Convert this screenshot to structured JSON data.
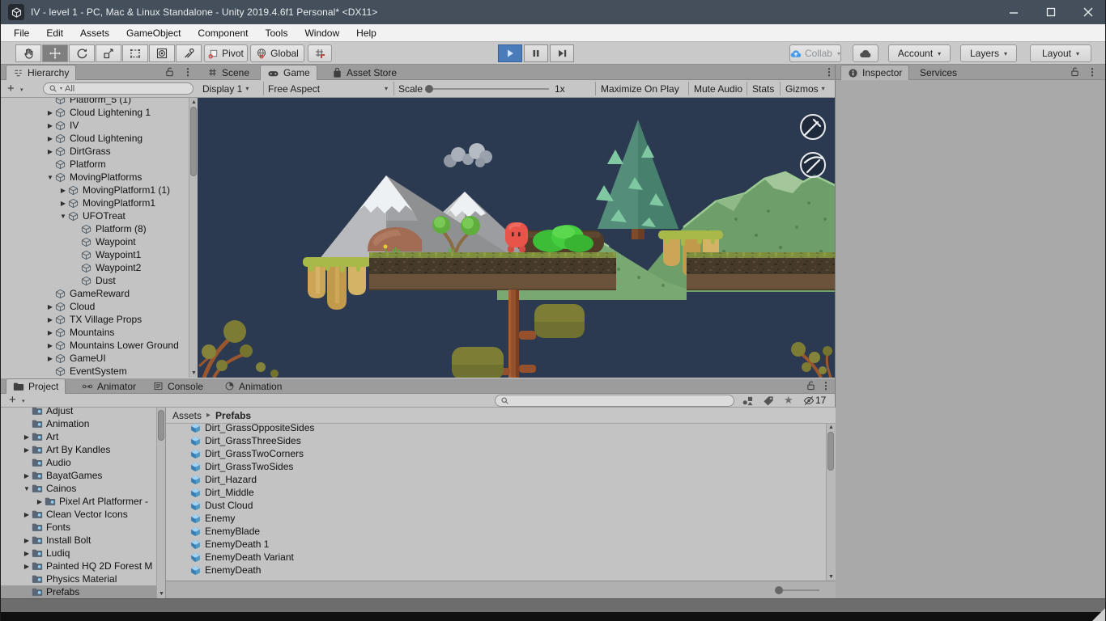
{
  "window": {
    "title": "IV - level 1 - PC, Mac & Linux Standalone - Unity 2019.4.6f1 Personal* <DX11>"
  },
  "menu": [
    "File",
    "Edit",
    "Assets",
    "GameObject",
    "Component",
    "Tools",
    "Window",
    "Help"
  ],
  "toolbar": {
    "pivot": "Pivot",
    "global": "Global",
    "collab": "Collab",
    "account": "Account",
    "layers": "Layers",
    "layout": "Layout"
  },
  "tabs": {
    "hierarchy": "Hierarchy",
    "scene": "Scene",
    "game": "Game",
    "asset_store": "Asset Store",
    "inspector": "Inspector",
    "services": "Services",
    "project": "Project",
    "animator": "Animator",
    "console": "Console",
    "animation": "Animation"
  },
  "hierarchy": {
    "search": "All",
    "items": [
      {
        "label": "Platform_5 (1)",
        "level": 2,
        "arrow": "none"
      },
      {
        "label": "Cloud Lightening 1",
        "level": 2,
        "arrow": "collapsed"
      },
      {
        "label": "IV",
        "level": 2,
        "arrow": "collapsed"
      },
      {
        "label": "Cloud Lightening",
        "level": 2,
        "arrow": "collapsed"
      },
      {
        "label": "DirtGrass",
        "level": 2,
        "arrow": "collapsed"
      },
      {
        "label": "Platform",
        "level": 2,
        "arrow": "none"
      },
      {
        "label": "MovingPlatforms",
        "level": 2,
        "arrow": "expanded"
      },
      {
        "label": "MovingPlatform1 (1)",
        "level": 3,
        "arrow": "collapsed"
      },
      {
        "label": "MovingPlatform1",
        "level": 3,
        "arrow": "collapsed"
      },
      {
        "label": "UFOTreat",
        "level": 3,
        "arrow": "expanded"
      },
      {
        "label": "Platform (8)",
        "level": 4,
        "arrow": "none"
      },
      {
        "label": "Waypoint",
        "level": 4,
        "arrow": "none"
      },
      {
        "label": "Waypoint1",
        "level": 4,
        "arrow": "none"
      },
      {
        "label": "Waypoint2",
        "level": 4,
        "arrow": "none"
      },
      {
        "label": "Dust",
        "level": 4,
        "arrow": "none"
      },
      {
        "label": "GameReward",
        "level": 2,
        "arrow": "none"
      },
      {
        "label": "Cloud",
        "level": 2,
        "arrow": "collapsed"
      },
      {
        "label": "TX Village Props",
        "level": 2,
        "arrow": "collapsed"
      },
      {
        "label": "Mountains",
        "level": 2,
        "arrow": "collapsed"
      },
      {
        "label": "Mountains Lower Ground",
        "level": 2,
        "arrow": "collapsed"
      },
      {
        "label": "GameUI",
        "level": 2,
        "arrow": "collapsed"
      },
      {
        "label": "EventSystem",
        "level": 2,
        "arrow": "none"
      }
    ]
  },
  "game_toolbar": {
    "display": "Display 1",
    "aspect": "Free Aspect",
    "scale_label": "Scale",
    "scale_value": "1x",
    "maximize": "Maximize On Play",
    "mute": "Mute Audio",
    "stats": "Stats",
    "gizmos": "Gizmos"
  },
  "game_view": {
    "hud_buttons": [
      {
        "icon": "dagger-icon"
      },
      {
        "icon": "pickaxe-icon"
      }
    ]
  },
  "project": {
    "hidden_count": "17",
    "breadcrumb": {
      "root": "Assets",
      "separator": ">",
      "current": "Prefabs"
    },
    "folders": [
      {
        "label": "Adjust",
        "level": 1,
        "arrow": "none"
      },
      {
        "label": "Animation",
        "level": 1,
        "arrow": "none"
      },
      {
        "label": "Art",
        "level": 1,
        "arrow": "collapsed"
      },
      {
        "label": "Art By Kandles",
        "level": 1,
        "arrow": "collapsed"
      },
      {
        "label": "Audio",
        "level": 1,
        "arrow": "none"
      },
      {
        "label": "BayatGames",
        "level": 1,
        "arrow": "collapsed"
      },
      {
        "label": "Cainos",
        "level": 1,
        "arrow": "expanded"
      },
      {
        "label": "Pixel Art Platformer -",
        "level": 2,
        "arrow": "collapsed"
      },
      {
        "label": "Clean Vector Icons",
        "level": 1,
        "arrow": "collapsed"
      },
      {
        "label": "Fonts",
        "level": 1,
        "arrow": "none"
      },
      {
        "label": "Install Bolt",
        "level": 1,
        "arrow": "collapsed"
      },
      {
        "label": "Ludiq",
        "level": 1,
        "arrow": "collapsed"
      },
      {
        "label": "Painted HQ 2D Forest M",
        "level": 1,
        "arrow": "collapsed"
      },
      {
        "label": "Physics Material",
        "level": 1,
        "arrow": "none"
      },
      {
        "label": "Prefabs",
        "level": 1,
        "arrow": "none",
        "selected": true
      }
    ],
    "assets": [
      {
        "label": "Dirt_GrassOppositeSides",
        "variant": false
      },
      {
        "label": "Dirt_GrassThreeSides",
        "variant": false
      },
      {
        "label": "Dirt_GrassTwoCorners",
        "variant": false
      },
      {
        "label": "Dirt_GrassTwoSides",
        "variant": false
      },
      {
        "label": "Dirt_Hazard",
        "variant": false
      },
      {
        "label": "Dirt_Middle",
        "variant": false
      },
      {
        "label": "Dust Cloud",
        "variant": false
      },
      {
        "label": "Enemy",
        "variant": false
      },
      {
        "label": "EnemyBlade",
        "variant": false
      },
      {
        "label": "EnemyDeath 1",
        "variant": true
      },
      {
        "label": "EnemyDeath Variant",
        "variant": true
      },
      {
        "label": "EnemyDeath",
        "variant": false
      }
    ]
  },
  "colors": {
    "titlebar": "#454f5b",
    "play_active": "#4a7cba",
    "game_background": "#2c3a51",
    "selection": "#9b9b9b",
    "prefab_icon_blue": "#4f98c6",
    "folder_dot_blue": "#8ad1f5",
    "collab_icon_blue": "#4a9ce8",
    "hud_ring": "#e9ecef"
  }
}
